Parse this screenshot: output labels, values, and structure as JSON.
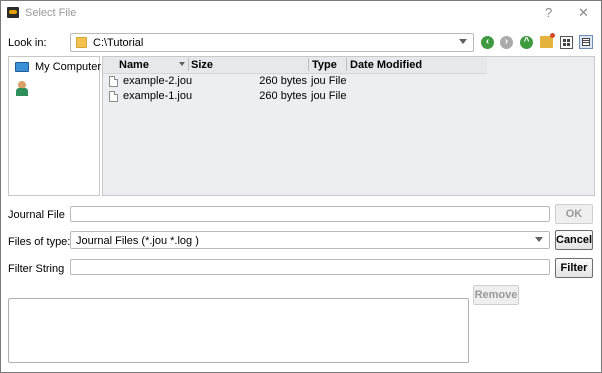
{
  "window": {
    "title": "Select File",
    "help_label": "?",
    "close_label": "✕"
  },
  "look_in": {
    "label": "Look in:",
    "value": "C:\\Tutorial"
  },
  "toolbar_icons": [
    "back-icon",
    "forward-icon",
    "up-icon",
    "new-folder-icon",
    "list-view-icon",
    "detail-view-icon"
  ],
  "sidebar": {
    "items": [
      {
        "label": "My Computer",
        "icon": "computer-icon"
      },
      {
        "label": "",
        "icon": "user-icon"
      }
    ]
  },
  "file_list": {
    "columns": [
      "Name",
      "Size",
      "Type",
      "Date Modified"
    ],
    "rows": [
      {
        "name": "example-2.jou",
        "size": "260 bytes",
        "type": "jou File",
        "date": ""
      },
      {
        "name": "example-1.jou",
        "size": "260 bytes",
        "type": "jou File",
        "date": ""
      }
    ]
  },
  "journal_file": {
    "label": "Journal File",
    "value": ""
  },
  "files_of_type": {
    "label": "Files of type:",
    "value": "Journal Files (*.jou *.log )"
  },
  "filter_string": {
    "label": "Filter String",
    "value": ""
  },
  "buttons": {
    "ok": "OK",
    "cancel": "Cancel",
    "filter": "Filter",
    "remove": "Remove"
  }
}
